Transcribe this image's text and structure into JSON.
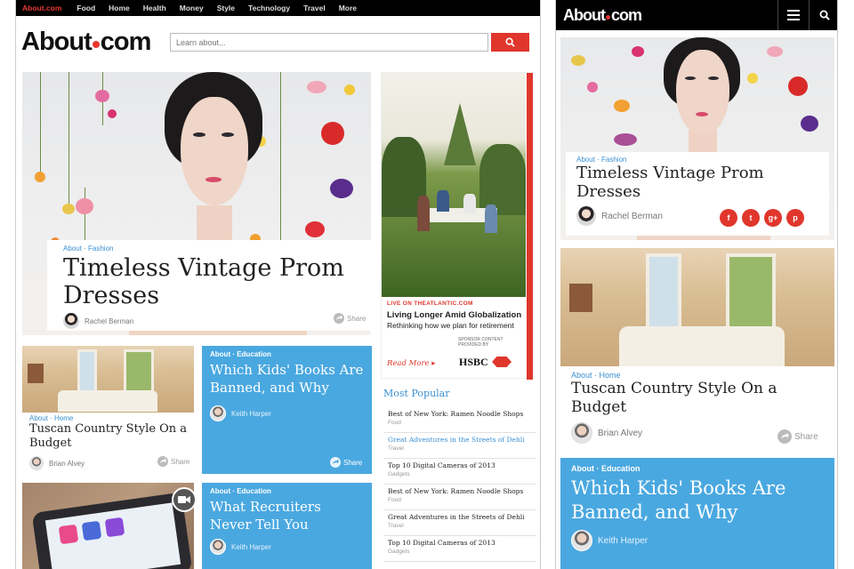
{
  "desktop": {
    "nav": {
      "brand": "About.com",
      "items": [
        "Food",
        "Home",
        "Health",
        "Money",
        "Style",
        "Technology",
        "Travel",
        "More"
      ]
    },
    "logo": {
      "before_dot": "About",
      "after_dot": "com"
    },
    "search": {
      "placeholder": "Learn about..."
    },
    "hero": {
      "crumb": "About · Fashion",
      "title": "Timeless Vintage Prom Dresses",
      "author": "Rachel Berman",
      "share": "Share"
    },
    "ad": {
      "label": "LIVE ON THEATLANTIC.COM",
      "title": "Living Longer Amid Globalization",
      "subtitle": "Rethinking how we plan for retirement",
      "sponsor": "SPONSOR CONTENT PROVIDED BY",
      "read_more": "Read More",
      "brand": "HSBC"
    },
    "most_popular": {
      "title": "Most Popular",
      "items": [
        {
          "title": "Best of New York: Ramen Noodle Shops",
          "category": "Food",
          "link": false
        },
        {
          "title": "Great Adventures in the Streets of Dehli",
          "category": "Travel",
          "link": true
        },
        {
          "title": "Top 10 Digital Cameras of 2013",
          "category": "Gadgets",
          "link": false
        },
        {
          "title": "Best of New York: Ramen Noodle Shops",
          "category": "Food",
          "link": false
        },
        {
          "title": "Great Adventures in the Streets of Dehli",
          "category": "Travel",
          "link": false
        },
        {
          "title": "Top 10 Digital Cameras of 2013",
          "category": "Gadgets",
          "link": false
        }
      ]
    },
    "tuscan": {
      "crumb": "About · Home",
      "title": "Tuscan Country Style On a Budget",
      "author": "Brian Alvey",
      "share": "Share"
    },
    "kids": {
      "crumb": "About · Education",
      "title": "Which Kids' Books Are Banned, and Why",
      "author": "Keith Harper",
      "share": "Share"
    },
    "recruiters": {
      "crumb": "About · Education",
      "title": "What Recruiters Never Tell You",
      "author": "Keith Harper"
    }
  },
  "mobile": {
    "logo": {
      "before_dot": "About",
      "after_dot": "com"
    },
    "hero": {
      "crumb": "About · Fashion",
      "title": "Timeless Vintage Prom Dresses",
      "author": "Rachel Berman",
      "social": [
        "f",
        "t",
        "g+",
        "p"
      ]
    },
    "tuscan": {
      "crumb": "About · Home",
      "title": "Tuscan Country Style On a Budget",
      "author": "Brian Alvey",
      "share": "Share"
    },
    "kids": {
      "crumb": "About · Education",
      "title": "Which Kids' Books Are Banned, and Why",
      "author": "Keith Harper"
    }
  },
  "colors": {
    "brand_red": "#e0362c",
    "accent_blue": "#4aa8e0",
    "link_blue": "#3a8fd2"
  },
  "icons": {
    "search": "magnifier-icon",
    "menu": "hamburger-icon",
    "share": "share-arrow-icon",
    "video": "video-camera-icon"
  }
}
